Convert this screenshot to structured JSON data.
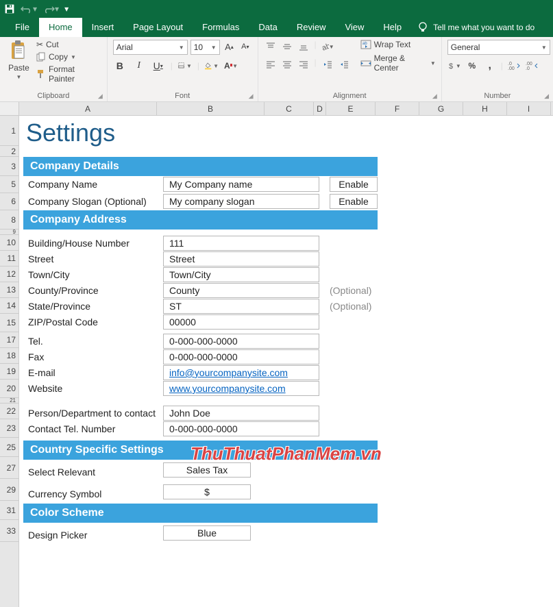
{
  "tabs": {
    "file": "File",
    "home": "Home",
    "insert": "Insert",
    "page_layout": "Page Layout",
    "formulas": "Formulas",
    "data": "Data",
    "review": "Review",
    "view": "View",
    "help": "Help",
    "tell_me": "Tell me what you want to do"
  },
  "ribbon": {
    "clipboard": {
      "paste": "Paste",
      "cut": "Cut",
      "copy": "Copy",
      "format_painter": "Format Painter",
      "label": "Clipboard"
    },
    "font": {
      "name": "Arial",
      "size": "10",
      "label": "Font"
    },
    "alignment": {
      "wrap_text": "Wrap Text",
      "merge_center": "Merge & Center",
      "label": "Alignment"
    },
    "number": {
      "format": "General",
      "label": "Number"
    }
  },
  "columns": [
    "A",
    "B",
    "C",
    "D",
    "E",
    "F",
    "G",
    "H",
    "I"
  ],
  "rows": [
    "1",
    "2",
    "3",
    "5",
    "6",
    "8",
    "9",
    "10",
    "11",
    "12",
    "13",
    "14",
    "15",
    "17",
    "18",
    "19",
    "20",
    "21",
    "22",
    "23",
    "25",
    "27",
    "29",
    "31",
    "33"
  ],
  "sheet": {
    "title": "Settings",
    "sections": {
      "details": "Company Details",
      "address": "Company Address",
      "country": "Country Specific Settings",
      "color": "Color Scheme"
    },
    "fields": {
      "company_name_label": "Company Name",
      "company_name_value": "My Company name",
      "company_slogan_label": "Company Slogan (Optional)",
      "company_slogan_value": "My company slogan",
      "enable": "Enable",
      "building_label": "Building/House Number",
      "building_value": "111",
      "street_label": "Street",
      "street_value": "Street",
      "town_label": "Town/City",
      "town_value": "Town/City",
      "county_label": "County/Province",
      "county_value": "County",
      "state_label": "State/Province",
      "state_value": "ST",
      "zip_label": "ZIP/Postal Code",
      "zip_value": "00000",
      "optional": "(Optional)",
      "tel_label": "Tel.",
      "tel_value": "0-000-000-0000",
      "fax_label": "Fax",
      "fax_value": "0-000-000-0000",
      "email_label": "E-mail",
      "email_value": "info@yourcompanysite.com",
      "website_label": "Website",
      "website_value": "www.yourcompanysite.com",
      "contact_person_label": "Person/Department to contact",
      "contact_person_value": "John Doe",
      "contact_tel_label": "Contact Tel. Number",
      "contact_tel_value": "0-000-000-0000",
      "select_relevant_label": "Select Relevant",
      "select_relevant_value": "Sales Tax",
      "currency_label": "Currency Symbol",
      "currency_value": "$",
      "design_picker_label": "Design Picker",
      "design_picker_value": "Blue"
    }
  },
  "watermark": "ThuThuatPhanMem.vn"
}
